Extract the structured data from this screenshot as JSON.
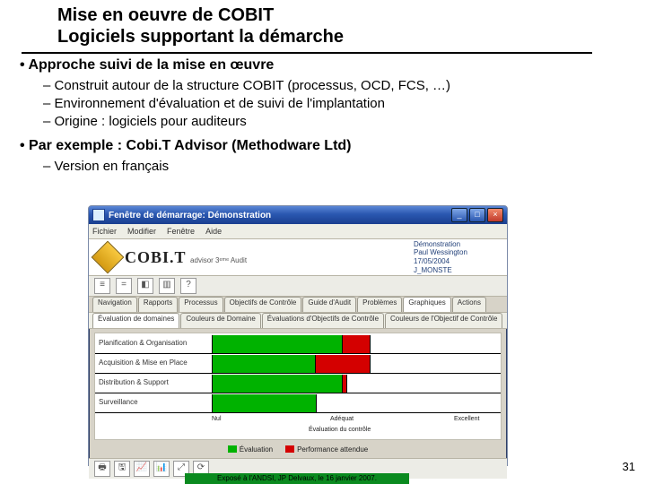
{
  "title": {
    "line1": "Mise en oeuvre de COBIT",
    "line2": "Logiciels supportant la démarche"
  },
  "bullets": {
    "b1": "Approche suivi de la mise en œuvre",
    "b1s1": "Construit autour de la structure COBIT (processus, OCD, FCS, …)",
    "b1s2": "Environnement d'évaluation et de suivi de l'implantation",
    "b1s3": "Origine : logiciels pour auditeurs",
    "b2": "Par exemple : Cobi.T Advisor (Methodware Ltd)",
    "b2s1": "Version en français"
  },
  "app": {
    "title": "Fenêtre de démarrage: Démonstration",
    "menu": {
      "m1": "Fichier",
      "m2": "Modifier",
      "m3": "Fenêtre",
      "m4": "Aide"
    },
    "brand": {
      "name": "COBI.T",
      "sub": "advisor 3ᵉᵐᵉ Audit"
    },
    "meta": {
      "l1": "Démonstration",
      "l2": "Paul Wessington",
      "l3": "17/05/2004",
      "l4": "J_MONSTE"
    },
    "tabs": {
      "t1": "Navigation",
      "t2": "Rapports",
      "t3": "Processus",
      "t4": "Objectifs de Contrôle",
      "t5": "Guide d'Audit",
      "t6": "Problèmes",
      "t7": "Graphiques",
      "t8": "Actions"
    },
    "subtabs": {
      "s1": "Évaluation de domaines",
      "s2": "Couleurs de Domaine",
      "s3": "Évaluations d'Objectifs de Contrôle",
      "s4": "Couleurs de l'Objectif de Contrôle"
    },
    "rows": {
      "r1": "Planification & Organisation",
      "r2": "Acquisition & Mise en Place",
      "r3": "Distribution & Support",
      "r4": "Surveillance"
    },
    "axis": {
      "x1": "Nul",
      "x2": "Adéquat",
      "x3": "Excellent",
      "xlabel": "Évaluation du contrôle"
    },
    "legend": {
      "l1": "Évaluation",
      "l2": "Performance attendue"
    }
  },
  "footer": "Exposé à l'ANDSI, JP Delvaux, le 16 janvier 2007.",
  "slide_number": "31",
  "chart_data": {
    "type": "bar",
    "title": "Évaluation de domaines",
    "xlabel": "Évaluation du contrôle",
    "x_ticks": [
      "Nul",
      "Adéquat",
      "Excellent"
    ],
    "categories": [
      "Planification & Organisation",
      "Acquisition & Mise en Place",
      "Distribution & Support",
      "Surveillance"
    ],
    "series": [
      {
        "name": "Évaluation",
        "color": "#00b200",
        "values": [
          2.5,
          2.0,
          2.5,
          2.0
        ]
      },
      {
        "name": "Performance attendue",
        "color": "#d40000",
        "values": [
          3.0,
          3.0,
          2.5,
          null
        ]
      }
    ],
    "xlim": [
      0,
      5
    ],
    "notes": "Values estimated from bar lengths on a 0–5 ordinal scale (Nul=0, Adéquat≈2.5, Excellent=5). Surveillance has no red segment."
  }
}
